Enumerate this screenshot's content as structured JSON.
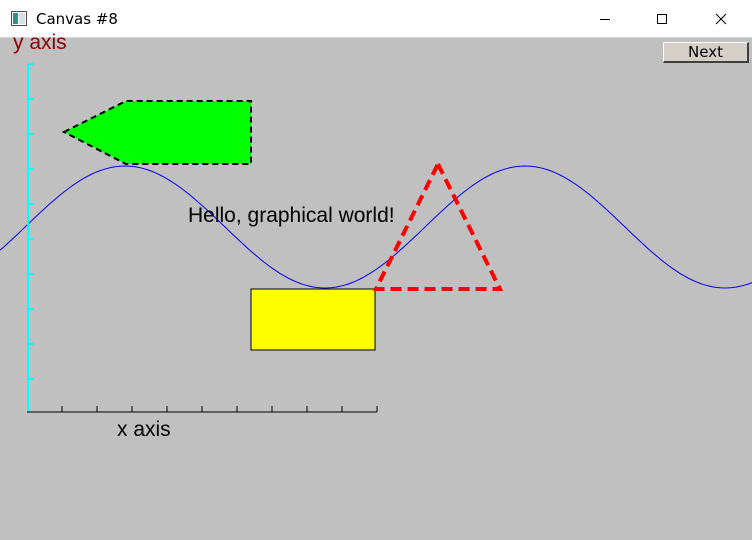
{
  "window": {
    "title": "Canvas #8",
    "controls": [
      "minimize-icon",
      "maximize-icon",
      "close-icon"
    ]
  },
  "canvas": {
    "next_button_label": "Next",
    "y_axis_label": "y axis",
    "x_axis_label": "x axis",
    "text": "Hello, graphical world!",
    "colors": {
      "background": "#c0c0c0",
      "y_axis": "#00ffff",
      "x_axis": "#000000",
      "y_label": "#8b0000",
      "sine_wave": "#0000ff",
      "pentagon_fill": "#00ff00",
      "pentagon_outline": "#000000",
      "rectangle_fill": "#ffff00",
      "triangle_outline": "#ff0000"
    }
  }
}
